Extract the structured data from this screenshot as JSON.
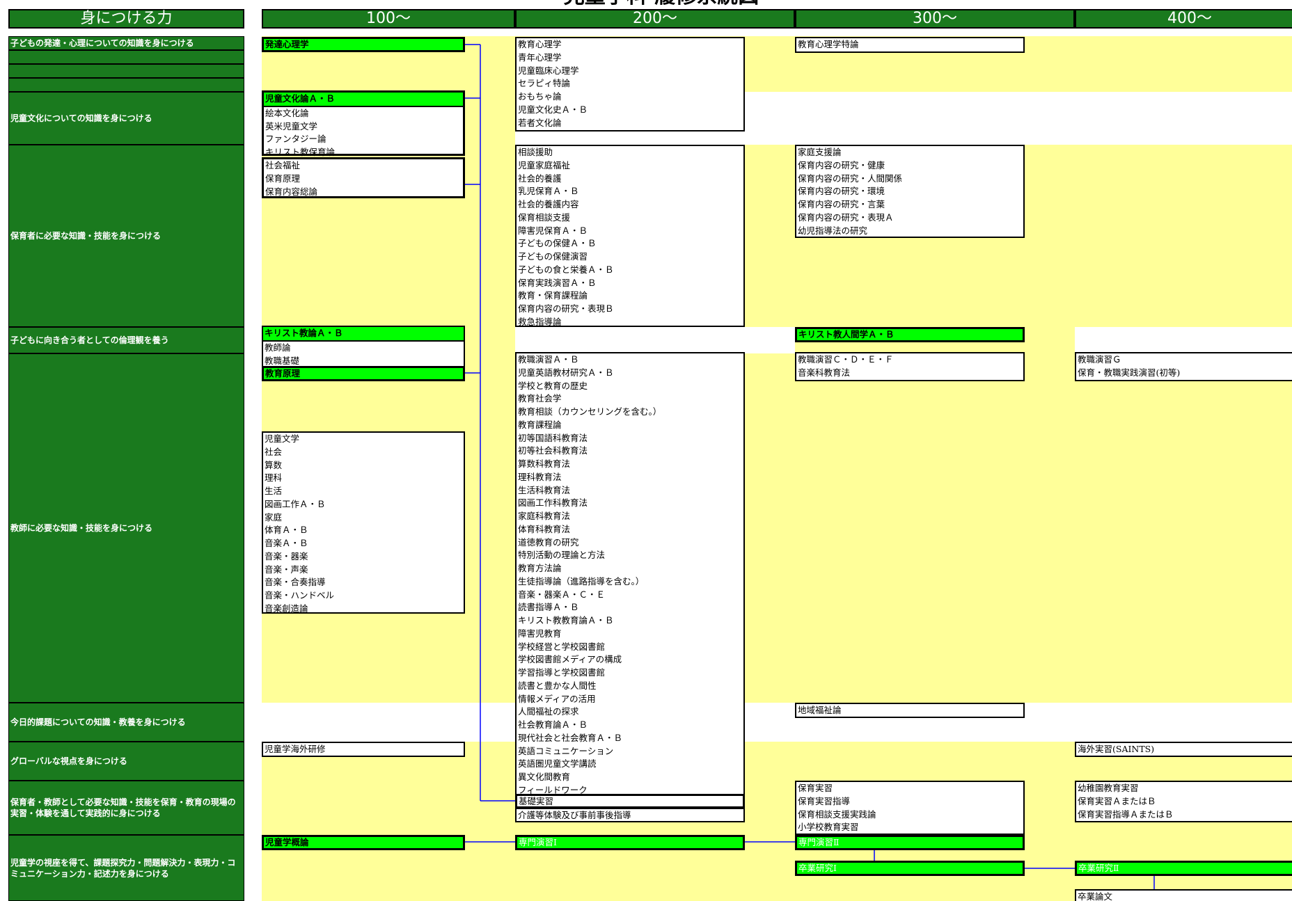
{
  "title": "児童学科 履修系統図",
  "headers": [
    "身につける力",
    "100～",
    "200～",
    "300～",
    "400～"
  ],
  "categories": [
    "子どもの発達・心理についての知識を身につける",
    "児童文化についての知識を身につける",
    "保育者に必要な知識・技能を身につける",
    "子どもに向き合う者としての倫理観を養う",
    "教師に必要な知識・技能を身につける",
    "今日的課題についての知識・教養を身につける",
    "グローバルな視点を身につける",
    "保育者・教師として必要な知識・技能を保育・教育の現場の実習・体験を通して実践的に身につける",
    "児童学の視座を得て、課題探究力・問題解決力・表現力・コミュニケーション力・記述力を身につける"
  ],
  "c100": {
    "hattatsu": "発達心理学",
    "bunka_head": "児童文化論Ａ・Ｂ",
    "bunka": [
      "絵本文化論",
      "英米児童文学",
      "ファンタジー論",
      "キリスト教保育論"
    ],
    "hoiku": [
      "社会福祉",
      "保育原理",
      "保育内容総論"
    ],
    "rinri": "キリスト教論Ａ・Ｂ",
    "kyoshi_a": [
      "教師論",
      "教職基礎"
    ],
    "kyoiku_genri": "教育原理",
    "kyoshi_b": [
      "児童文学",
      "社会",
      "算数",
      "理科",
      "生活",
      "図画工作Ａ・Ｂ",
      "家庭",
      "体育Ａ・Ｂ",
      "音楽Ａ・Ｂ",
      "音楽・器楽",
      "音楽・声楽",
      "音楽・合奏指導",
      "音楽・ハンドベル",
      "音楽創造論"
    ],
    "kaigai": "児童学海外研修",
    "gairon": "児童学概論"
  },
  "c200": {
    "shinri": [
      "教育心理学",
      "青年心理学",
      "児童臨床心理学",
      "セラピィ特論",
      "おもちゃ論",
      "児童文化史Ａ・Ｂ",
      "若者文化論"
    ],
    "hoiku": [
      "相談援助",
      "児童家庭福祉",
      "社会的養護",
      "乳児保育Ａ・Ｂ",
      "社会的養護内容",
      "保育相談支援",
      "障害児保育Ａ・Ｂ",
      "子どもの保健Ａ・Ｂ",
      "子どもの保健演習",
      "子どもの食と栄養Ａ・Ｂ",
      "保育実践演習Ａ・Ｂ",
      "教育・保育課程論",
      "保育内容の研究・表現Ｂ",
      "救急指導論"
    ],
    "kyoshi": [
      "教職演習Ａ・Ｂ",
      "児童英語教材研究Ａ・Ｂ",
      "学校と教育の歴史",
      "教育社会学",
      "教育相談（カウンセリングを含む。）",
      "教育課程論",
      "初等国語科教育法",
      "初等社会科教育法",
      "算数科教育法",
      "理科教育法",
      "生活科教育法",
      "図画工作科教育法",
      "家庭科教育法",
      "体育科教育法",
      "道徳教育の研究",
      "特別活動の理論と方法",
      "教育方法論",
      "生徒指導論（進路指導を含む。）",
      "音楽・器楽Ａ・Ｃ・Ｅ",
      "読書指導Ａ・Ｂ",
      "キリスト教教育論Ａ・Ｂ",
      "障害児教育",
      "学校経営と学校図書館",
      "学校図書館メディアの構成",
      "学習指導と学校図書館",
      "読書と豊かな人間性",
      "情報メディアの活用",
      "人間福祉の探求",
      "社会教育論Ａ・Ｂ",
      "現代社会と社会教育Ａ・Ｂ",
      "英語コミュニケーション",
      "英語圏児童文学講読",
      "異文化間教育",
      "フィールドワーク"
    ],
    "kiso": "基礎実習",
    "kaigo": "介護等体験及び事前事後指導",
    "semi1": "専門演習Ⅰ"
  },
  "c300": {
    "shinri": "教育心理学特論",
    "hoiku": [
      "家庭支援論",
      "保育内容の研究・健康",
      "保育内容の研究・人間関係",
      "保育内容の研究・環境",
      "保育内容の研究・言葉",
      "保育内容の研究・表現Ａ",
      "幼児指導法の研究"
    ],
    "ningen": "キリスト教人間学Ａ・Ｂ",
    "kyoshi": [
      "教職演習Ｃ・Ｄ・Ｅ・Ｆ",
      "音楽科教育法"
    ],
    "chiiki": "地域福祉論",
    "jisshu": [
      "保育実習",
      "保育実習指導",
      "保育相談支援実践論",
      "小学校教育実習"
    ],
    "semi2": "専門演習Ⅱ",
    "sotsu1": "卒業研究Ⅰ"
  },
  "c400": {
    "kyoshi": [
      "教職演習Ｇ",
      "保育・教職実践演習(初等)"
    ],
    "kaigai": "海外実習(SAINTS)",
    "jisshu": [
      "幼稚園教育実習",
      "保育実習ＡまたはＢ",
      "保育実習指導ＡまたはＢ"
    ],
    "sotsu2": "卒業研究Ⅱ",
    "ronbun": "卒業論文"
  },
  "colors": {
    "header_green": "#1a7a1e",
    "band_yellow": "#ffff99",
    "highlight_green": "#00ff00",
    "connector_blue": "#0000ff"
  }
}
